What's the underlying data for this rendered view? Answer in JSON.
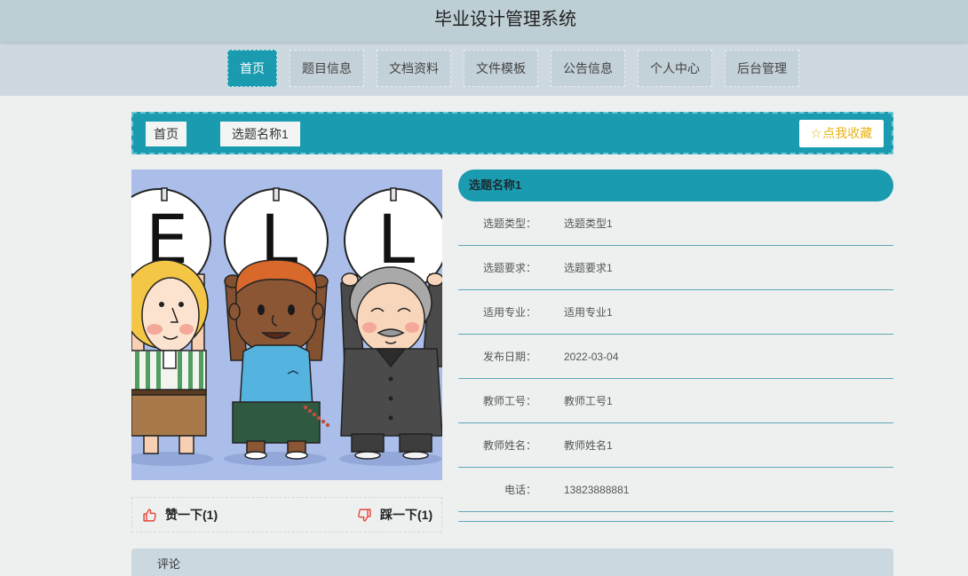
{
  "app": {
    "title": "毕业设计管理系统"
  },
  "nav": {
    "items": [
      {
        "label": "首页",
        "active": true
      },
      {
        "label": "题目信息",
        "active": false
      },
      {
        "label": "文档资料",
        "active": false
      },
      {
        "label": "文件模板",
        "active": false
      },
      {
        "label": "公告信息",
        "active": false
      },
      {
        "label": "个人中心",
        "active": false
      },
      {
        "label": "后台管理",
        "active": false
      }
    ]
  },
  "breadcrumb": {
    "home": "首页",
    "current": "选题名称1"
  },
  "favorite": {
    "icon": "star-outline-icon",
    "star_glyph": "☆",
    "label": "点我收藏"
  },
  "cover_image": {
    "sign_letters": [
      "E",
      "L",
      "L"
    ]
  },
  "votes": {
    "like": {
      "icon": "thumbs-up-icon",
      "label": "赞一下(1)"
    },
    "dislike": {
      "icon": "thumbs-down-icon",
      "label": "踩一下(1)"
    }
  },
  "detail": {
    "title": "选题名称1",
    "fields": [
      {
        "label": "选题类型：",
        "value": "选题类型1"
      },
      {
        "label": "选题要求：",
        "value": "选题要求1"
      },
      {
        "label": "适用专业：",
        "value": "适用专业1"
      },
      {
        "label": "发布日期：",
        "value": "2022-03-04"
      },
      {
        "label": "教师工号：",
        "value": "教师工号1"
      },
      {
        "label": "教师姓名：",
        "value": "教师姓名1"
      },
      {
        "label": "电话：",
        "value": "13823888881"
      }
    ]
  },
  "comments": {
    "title": "评论"
  },
  "colors": {
    "accent": "#1a9bb0",
    "header_bg": "#bdced5",
    "nav_bg": "#cdd9df",
    "page_bg": "#eef0f0",
    "favorite_text": "#e7b416",
    "vote_icon": "#e5463a"
  }
}
